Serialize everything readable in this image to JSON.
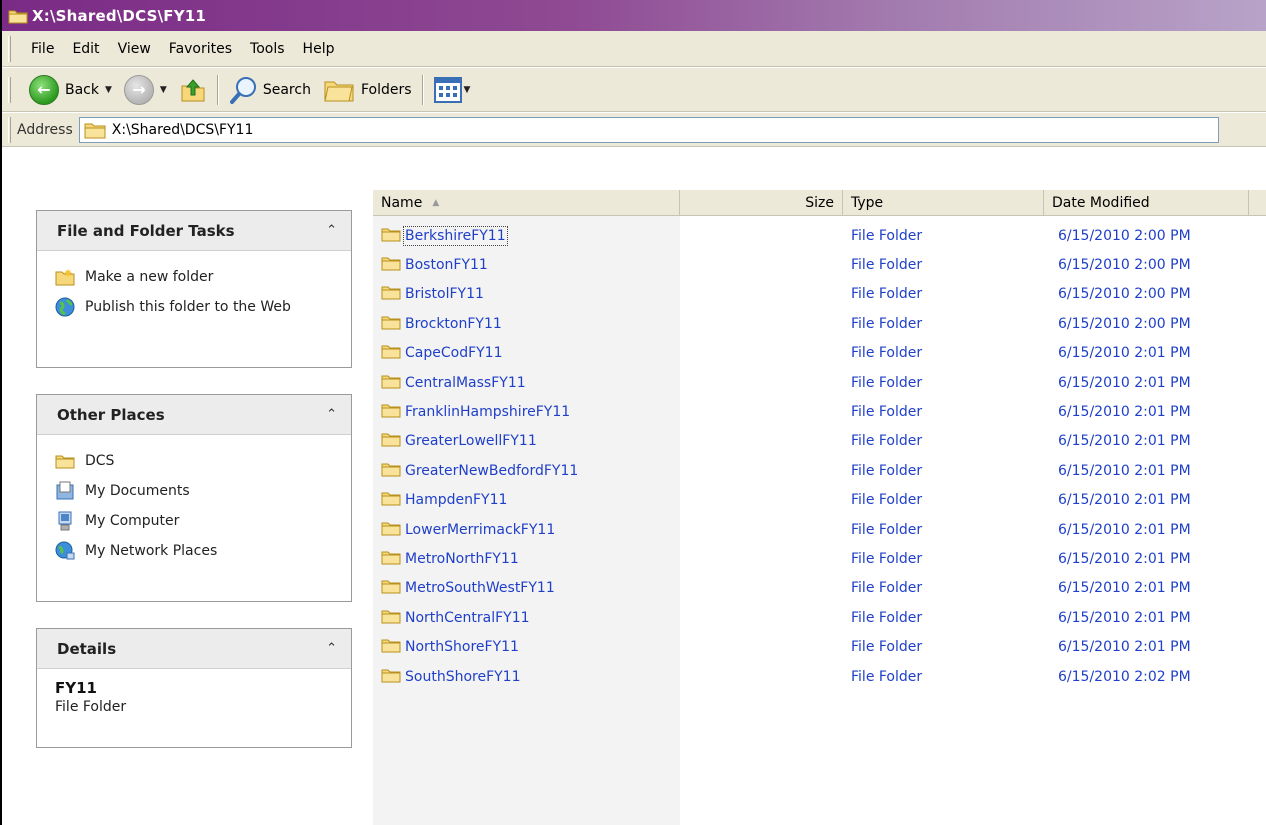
{
  "window": {
    "title": "X:\\Shared\\DCS\\FY11"
  },
  "menu": [
    "File",
    "Edit",
    "View",
    "Favorites",
    "Tools",
    "Help"
  ],
  "toolbar": {
    "back": "Back",
    "search": "Search",
    "folders": "Folders"
  },
  "address": {
    "label": "Address",
    "value": "X:\\Shared\\DCS\\FY11"
  },
  "tasks": {
    "title": "File and Folder Tasks",
    "items": [
      "Make a new folder",
      "Publish this folder to the Web"
    ]
  },
  "places": {
    "title": "Other Places",
    "items": [
      "DCS",
      "My Documents",
      "My Computer",
      "My Network Places"
    ]
  },
  "details": {
    "title": "Details",
    "name": "FY11",
    "type": "File Folder"
  },
  "columns": {
    "name": "Name",
    "size": "Size",
    "type": "Type",
    "date": "Date Modified"
  },
  "files": [
    {
      "name": "BerkshireFY11",
      "type": "File Folder",
      "date": "6/15/2010 2:00 PM"
    },
    {
      "name": "BostonFY11",
      "type": "File Folder",
      "date": "6/15/2010 2:00 PM"
    },
    {
      "name": "BristolFY11",
      "type": "File Folder",
      "date": "6/15/2010 2:00 PM"
    },
    {
      "name": "BrocktonFY11",
      "type": "File Folder",
      "date": "6/15/2010 2:00 PM"
    },
    {
      "name": "CapeCodFY11",
      "type": "File Folder",
      "date": "6/15/2010 2:01 PM"
    },
    {
      "name": "CentralMassFY11",
      "type": "File Folder",
      "date": "6/15/2010 2:01 PM"
    },
    {
      "name": "FranklinHampshireFY11",
      "type": "File Folder",
      "date": "6/15/2010 2:01 PM"
    },
    {
      "name": "GreaterLowellFY11",
      "type": "File Folder",
      "date": "6/15/2010 2:01 PM"
    },
    {
      "name": "GreaterNewBedfordFY11",
      "type": "File Folder",
      "date": "6/15/2010 2:01 PM"
    },
    {
      "name": "HampdenFY11",
      "type": "File Folder",
      "date": "6/15/2010 2:01 PM"
    },
    {
      "name": "LowerMerrimackFY11",
      "type": "File Folder",
      "date": "6/15/2010 2:01 PM"
    },
    {
      "name": "MetroNorthFY11",
      "type": "File Folder",
      "date": "6/15/2010 2:01 PM"
    },
    {
      "name": "MetroSouthWestFY11",
      "type": "File Folder",
      "date": "6/15/2010 2:01 PM"
    },
    {
      "name": "NorthCentralFY11",
      "type": "File Folder",
      "date": "6/15/2010 2:01 PM"
    },
    {
      "name": "NorthShoreFY11",
      "type": "File Folder",
      "date": "6/15/2010 2:01 PM"
    },
    {
      "name": "SouthShoreFY11",
      "type": "File Folder",
      "date": "6/15/2010 2:02 PM"
    }
  ]
}
